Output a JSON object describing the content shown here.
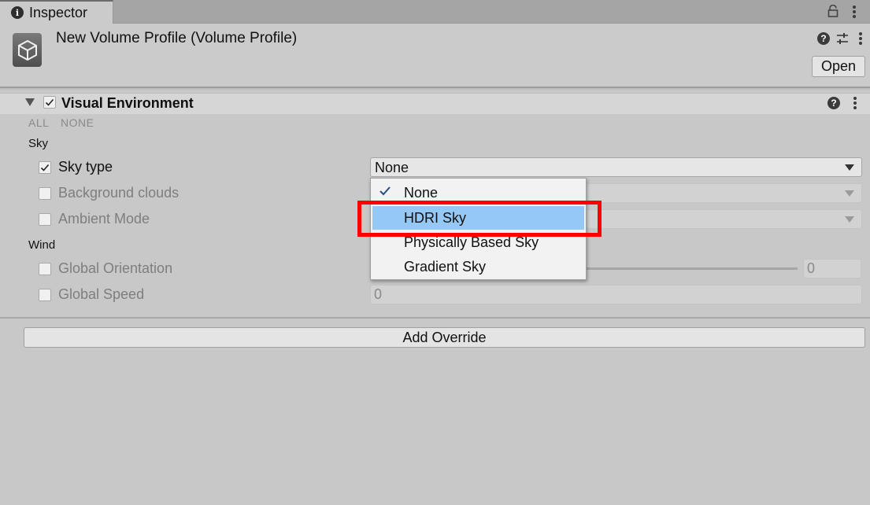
{
  "tab": {
    "label": "Inspector",
    "icon": "info-icon"
  },
  "header": {
    "title": "New Volume Profile (Volume Profile)",
    "open_label": "Open"
  },
  "component": {
    "title": "Visual Environment",
    "enabled": true,
    "all_label": "ALL",
    "none_label": "NONE"
  },
  "groups": {
    "sky": "Sky",
    "wind": "Wind"
  },
  "properties": {
    "sky_type": {
      "label": "Sky type",
      "checked": true,
      "value": "None"
    },
    "background_clouds": {
      "label": "Background clouds",
      "checked": false
    },
    "ambient_mode": {
      "label": "Ambient Mode",
      "checked": false
    },
    "global_orientation": {
      "label": "Global Orientation",
      "checked": false,
      "value": "0"
    },
    "global_speed": {
      "label": "Global Speed",
      "checked": false,
      "value": "0"
    }
  },
  "popup": {
    "items": [
      {
        "label": "None",
        "selected": true,
        "hovered": false
      },
      {
        "label": "HDRI Sky",
        "selected": false,
        "hovered": true
      },
      {
        "label": "Physically Based Sky",
        "selected": false,
        "hovered": false
      },
      {
        "label": "Gradient Sky",
        "selected": false,
        "hovered": false
      }
    ]
  },
  "add_override_label": "Add Override",
  "colors": {
    "background": "#c8c8c8",
    "hover_highlight": "#96c8f5",
    "annotation_red": "#ff0000"
  }
}
